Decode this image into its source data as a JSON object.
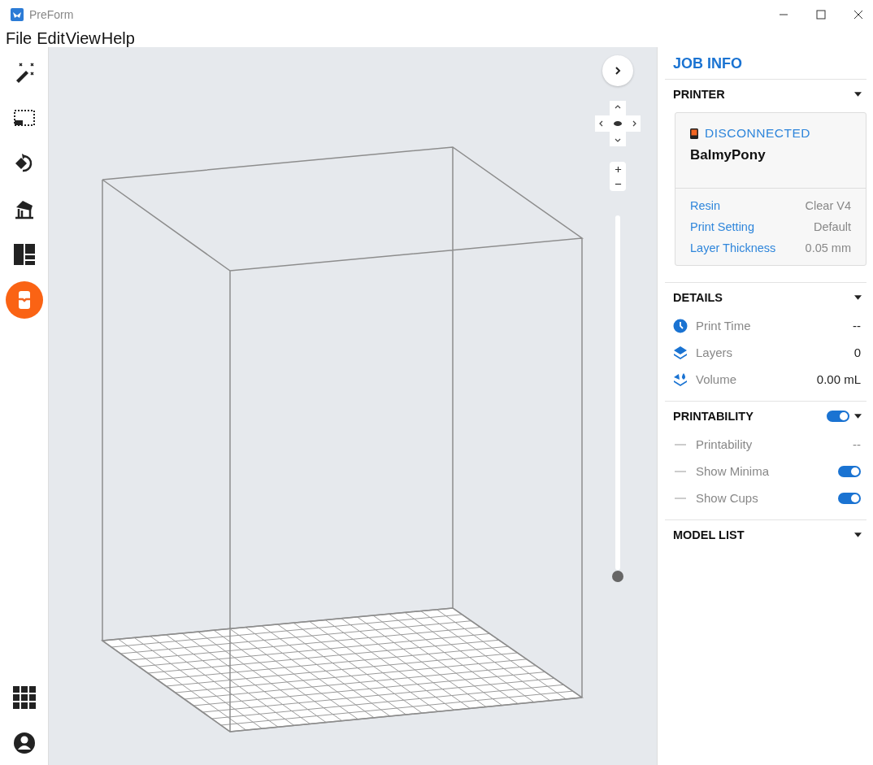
{
  "window": {
    "title": "PreForm"
  },
  "menu": [
    "File",
    "Edit",
    "View",
    "Help"
  ],
  "toolbar": [
    {
      "kind": "wand",
      "selected": false
    },
    {
      "kind": "select",
      "selected": false
    },
    {
      "kind": "orient",
      "selected": false
    },
    {
      "kind": "supports",
      "selected": false
    },
    {
      "kind": "layout",
      "selected": false
    },
    {
      "kind": "printer",
      "selected": true
    }
  ],
  "toolbar_bottom": [
    {
      "kind": "apps"
    },
    {
      "kind": "account"
    }
  ],
  "panel": {
    "title": "JOB INFO",
    "printer": {
      "title": "PRINTER",
      "status": "DISCONNECTED",
      "name": "BalmyPony",
      "properties": [
        {
          "label": "Resin",
          "value": "Clear V4"
        },
        {
          "label": "Print Setting",
          "value": "Default"
        },
        {
          "label": "Layer Thickness",
          "value": "0.05 mm"
        }
      ]
    },
    "details": {
      "title": "DETAILS",
      "rows": [
        {
          "kind": "clock",
          "label": "Print Time",
          "value": "--"
        },
        {
          "kind": "layers",
          "label": "Layers",
          "value": "0"
        },
        {
          "kind": "volume",
          "label": "Volume",
          "value": "0.00 mL"
        }
      ]
    },
    "printability": {
      "title": "PRINTABILITY",
      "on": true,
      "rows": [
        {
          "kind": "value",
          "label": "Printability",
          "value": "--"
        },
        {
          "kind": "toggle",
          "label": "Show Minima",
          "on": true
        },
        {
          "kind": "toggle",
          "label": "Show Cups",
          "on": true
        }
      ]
    },
    "model_list": {
      "title": "MODEL LIST"
    }
  }
}
